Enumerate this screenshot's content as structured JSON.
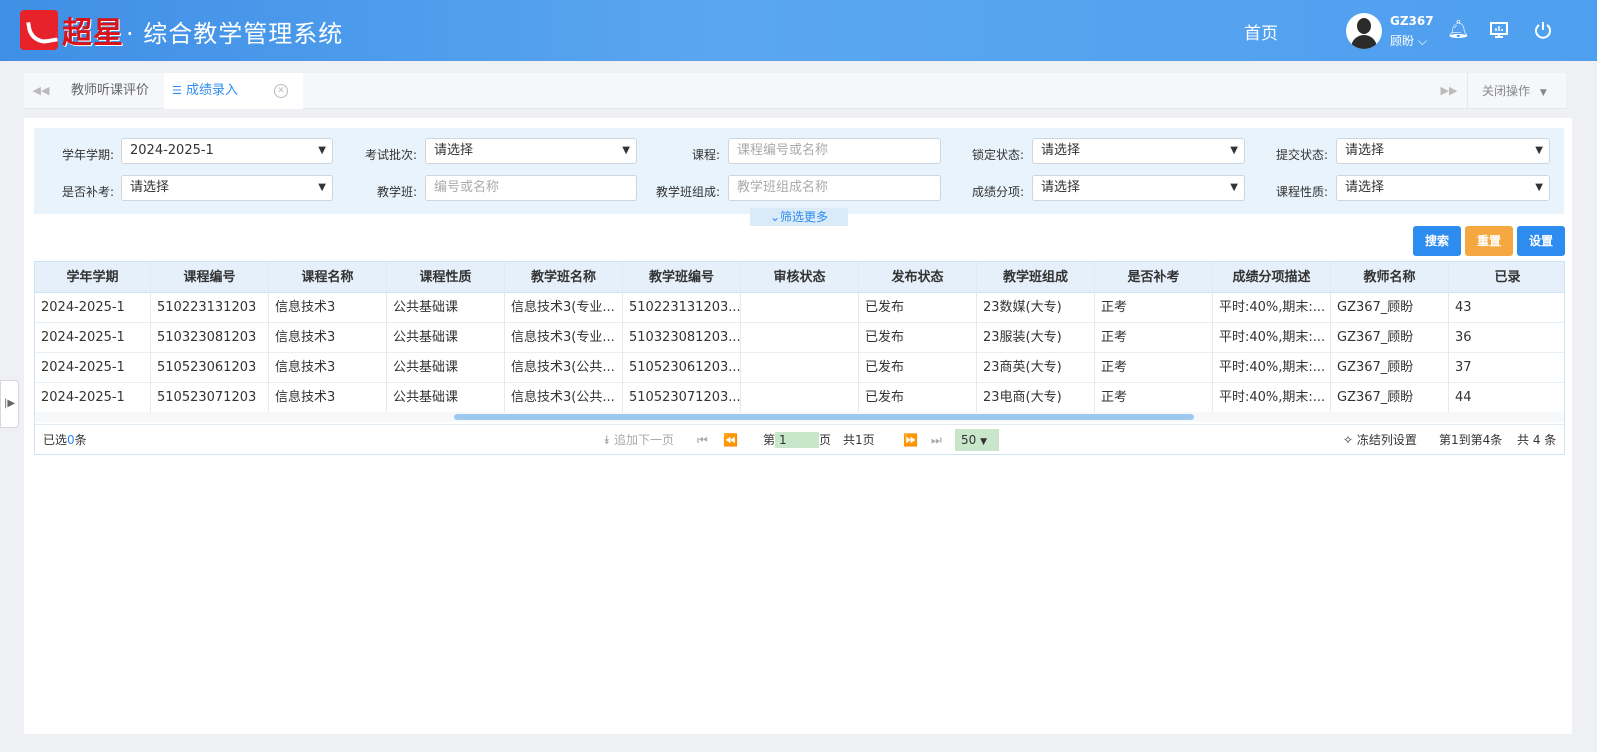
{
  "header": {
    "logo_text": "超星",
    "system_title": "· 综合教学管理系统",
    "home": "首页",
    "user_code": "GZ367",
    "user_name": "顾盼"
  },
  "tabs": {
    "items": [
      "教师听课评价",
      "成绩录入"
    ],
    "close_ops": "关闭操作"
  },
  "filters": {
    "term": {
      "label": "学年学期:",
      "value": "2024-2025-1"
    },
    "batch": {
      "label": "考试批次:",
      "value": "请选择"
    },
    "course": {
      "label": "课程:",
      "placeholder": "课程编号或名称"
    },
    "lock": {
      "label": "锁定状态:",
      "value": "请选择"
    },
    "submit": {
      "label": "提交状态:",
      "value": "请选择"
    },
    "makeup": {
      "label": "是否补考:",
      "value": "请选择"
    },
    "class": {
      "label": "教学班:",
      "placeholder": "编号或名称"
    },
    "class_group": {
      "label": "教学班组成:",
      "placeholder": "教学班组成名称"
    },
    "score_item": {
      "label": "成绩分项:",
      "value": "请选择"
    },
    "course_type": {
      "label": "课程性质:",
      "value": "请选择"
    },
    "more": "筛选更多"
  },
  "buttons": {
    "search": "搜索",
    "reset": "重置",
    "settings": "设置"
  },
  "table": {
    "headers": [
      "学年学期",
      "课程编号",
      "课程名称",
      "课程性质",
      "教学班名称",
      "教学班编号",
      "审核状态",
      "发布状态",
      "教学班组成",
      "是否补考",
      "成绩分项描述",
      "教师名称",
      "已录"
    ],
    "rows": [
      [
        "2024-2025-1",
        "510223131203",
        "信息技术3",
        "公共基础课",
        "信息技术3(专业...",
        "510223131203...",
        "",
        "已发布",
        "23数媒(大专)",
        "正考",
        "平时:40%,期末:...",
        "GZ367_顾盼",
        "43"
      ],
      [
        "2024-2025-1",
        "510323081203",
        "信息技术3",
        "公共基础课",
        "信息技术3(专业...",
        "510323081203...",
        "",
        "已发布",
        "23服装(大专)",
        "正考",
        "平时:40%,期末:...",
        "GZ367_顾盼",
        "36"
      ],
      [
        "2024-2025-1",
        "510523061203",
        "信息技术3",
        "公共基础课",
        "信息技术3(公共...",
        "510523061203...",
        "",
        "已发布",
        "23商英(大专)",
        "正考",
        "平时:40%,期末:...",
        "GZ367_顾盼",
        "37"
      ],
      [
        "2024-2025-1",
        "510523071203",
        "信息技术3",
        "公共基础课",
        "信息技术3(公共...",
        "510523071203...",
        "",
        "已发布",
        "23电商(大专)",
        "正考",
        "平时:40%,期末:...",
        "GZ367_顾盼",
        "44"
      ]
    ]
  },
  "pager": {
    "selected_prefix": "已选",
    "selected_count": "0",
    "selected_suffix": "条",
    "append_next": "追加下一页",
    "page_prefix": "第",
    "page_value": "1",
    "page_suffix": "页",
    "total_pages": "共1页",
    "page_size": "50",
    "freeze": "冻结列设置",
    "range": "第1到第4条",
    "total": "共 4 条"
  },
  "colors": {
    "primary": "#2d8cf0",
    "reset": "#f5a742",
    "header": "#4f9ff0"
  }
}
